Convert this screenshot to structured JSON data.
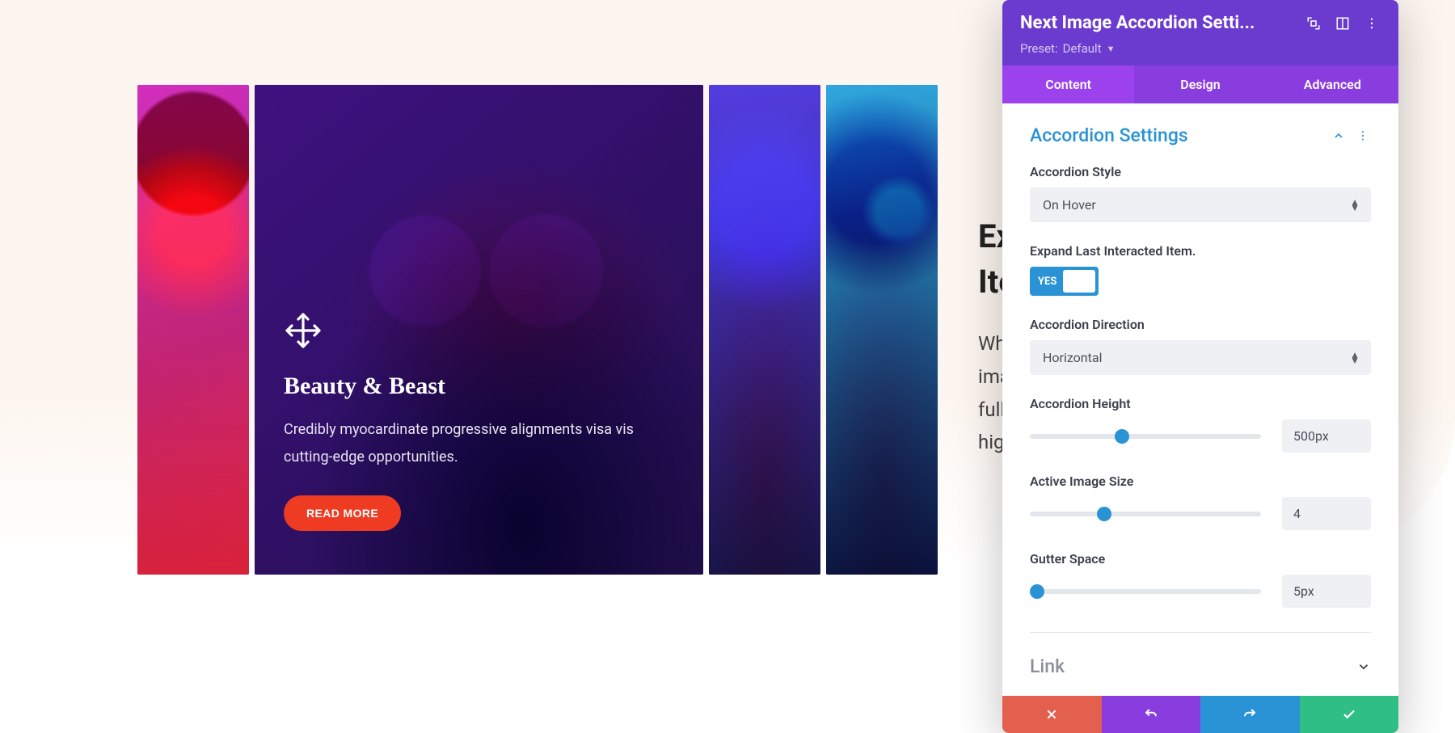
{
  "preview": {
    "active": {
      "title": "Beauty & Beast",
      "description": "Credibly myocardinate progressive alignments visa vis cutting-edge opportunities.",
      "button": "READ MORE"
    }
  },
  "sideText": {
    "line1": "Ex",
    "line2": "Ite",
    "p1": "Wh",
    "p2": "ima",
    "p3": "full",
    "p4": "hig"
  },
  "panel": {
    "title": "Next Image Accordion Setti...",
    "presetLabel": "Preset:",
    "presetValue": "Default",
    "tabs": {
      "content": "Content",
      "design": "Design",
      "advanced": "Advanced"
    },
    "section": {
      "title": "Accordion Settings",
      "style": {
        "label": "Accordion Style",
        "value": "On Hover"
      },
      "expandLast": {
        "label": "Expand Last Interacted Item.",
        "value": "YES"
      },
      "direction": {
        "label": "Accordion Direction",
        "value": "Horizontal"
      },
      "height": {
        "label": "Accordion Height",
        "value": "500px",
        "thumbPct": 40
      },
      "activeSize": {
        "label": "Active Image Size",
        "value": "4",
        "thumbPct": 32
      },
      "gutter": {
        "label": "Gutter Space",
        "value": "5px",
        "thumbPct": 3
      }
    },
    "link": {
      "title": "Link"
    }
  }
}
